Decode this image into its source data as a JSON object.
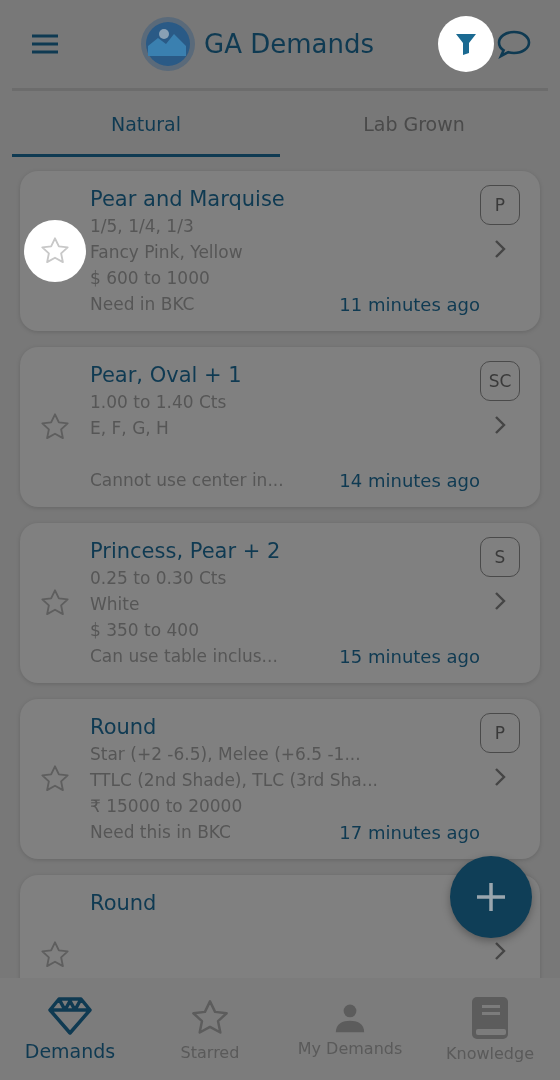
{
  "header": {
    "title": "GA Demands",
    "filter_spotlight": true
  },
  "tabs": [
    {
      "label": "Natural",
      "selected": true
    },
    {
      "label": "Lab Grown",
      "selected": false
    }
  ],
  "cards": [
    {
      "title": "Pear and Marquise",
      "details": [
        "1/5, 1/4, 1/3",
        "Fancy Pink, Yellow",
        "$ 600 to 1000"
      ],
      "note": "Need in BKC",
      "time": "11 minutes ago",
      "badge": "P",
      "star_spotlight": true
    },
    {
      "title": "Pear, Oval + 1",
      "details": [
        "1.00 to 1.40 Cts",
        "E, F, G, H"
      ],
      "note": "Cannot use center in...",
      "time": "14 minutes ago",
      "badge": "SC",
      "star_spotlight": false
    },
    {
      "title": "Princess, Pear + 2",
      "details": [
        "0.25 to 0.30 Cts",
        "White",
        "$ 350 to 400"
      ],
      "note": "Can use table inclus...",
      "time": "15 minutes ago",
      "badge": "S",
      "star_spotlight": false
    },
    {
      "title": "Round",
      "details": [
        "Star (+2 -6.5), Melee (+6.5 -1...",
        "TTLC (2nd Shade), TLC (3rd Sha...",
        "₹ 15000 to 20000"
      ],
      "note": "Need this in BKC",
      "time": "17 minutes ago",
      "badge": "P",
      "star_spotlight": false
    },
    {
      "title": "Round",
      "star_spotlight": false
    }
  ],
  "nav": [
    {
      "label": "Demands",
      "selected": true
    },
    {
      "label": "Starred",
      "selected": false
    },
    {
      "label": "My Demands",
      "selected": false
    },
    {
      "label": "Knowledge",
      "selected": false
    }
  ]
}
